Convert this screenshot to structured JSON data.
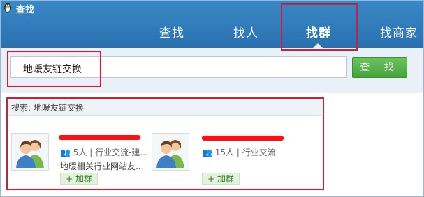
{
  "window": {
    "title": "查找"
  },
  "tabs": [
    "查找",
    "找人",
    "找群",
    "找商家"
  ],
  "active_tab": "找群",
  "search": {
    "value": "地暖友链交换",
    "button_label": "查 找"
  },
  "results_header": "搜索: 地暖友链交换",
  "results": [
    {
      "members": "5人",
      "category": "行业交流-建...",
      "desc": "地暖相关行业网站友...",
      "join_label": "+ 加群",
      "name_prefix": ""
    },
    {
      "members": "15人",
      "category": "行业交流",
      "desc": "",
      "join_label": "+ 加群",
      "name_prefix": ""
    }
  ],
  "colors": {
    "header": "#2f78b7",
    "highlight": "#d51d2f",
    "button": "#4fae43"
  }
}
